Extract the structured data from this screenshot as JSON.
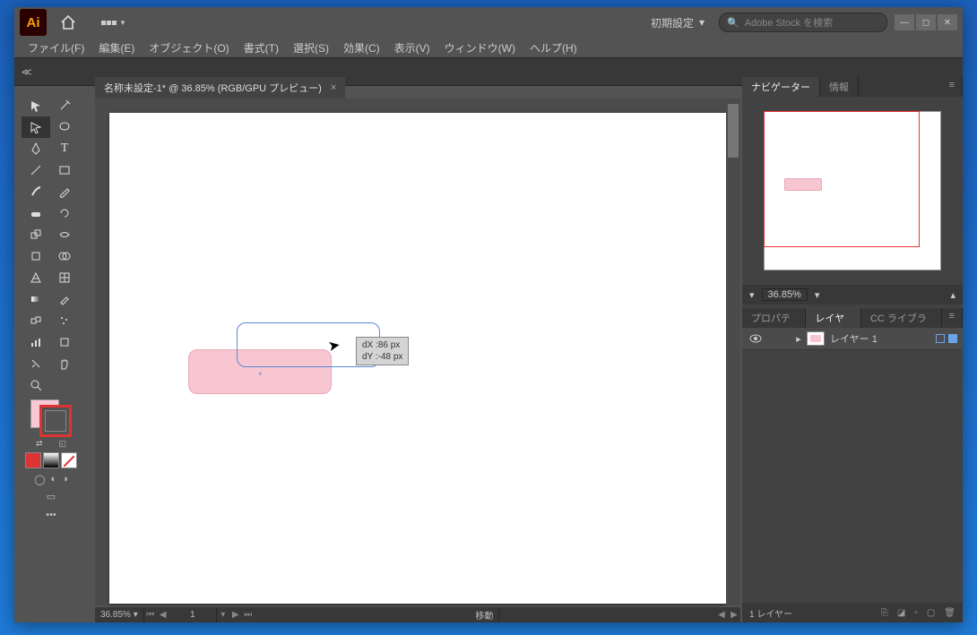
{
  "top": {
    "logo": "Ai",
    "workspace": "初期設定",
    "search_placeholder": "Adobe Stock を検索"
  },
  "menu": {
    "file": "ファイル(F)",
    "edit": "編集(E)",
    "object": "オブジェクト(O)",
    "type": "書式(T)",
    "select": "選択(S)",
    "effect": "効果(C)",
    "view": "表示(V)",
    "window": "ウィンドウ(W)",
    "help": "ヘルプ(H)"
  },
  "ctrl": {
    "collapse": "≪"
  },
  "doc": {
    "tab": "名称未設定-1* @ 36.85% (RGB/GPU プレビュー)",
    "zoom": "36.85%",
    "artboard_no": "1",
    "tool_status": "移動"
  },
  "measure": {
    "dx": "dX :86 px",
    "dy": "dY :-48 px"
  },
  "panels": {
    "navigator": "ナビゲーター",
    "info": "情報",
    "nav_zoom": "36.85%",
    "properties": "プロパティ",
    "layers": "レイヤー",
    "cc": "CC ライブラリ"
  },
  "layers": {
    "name": "レイヤー 1",
    "count": "1 レイヤー"
  },
  "colors": {
    "fill": "#f8c9d4",
    "stroke_outer": "#d33"
  }
}
